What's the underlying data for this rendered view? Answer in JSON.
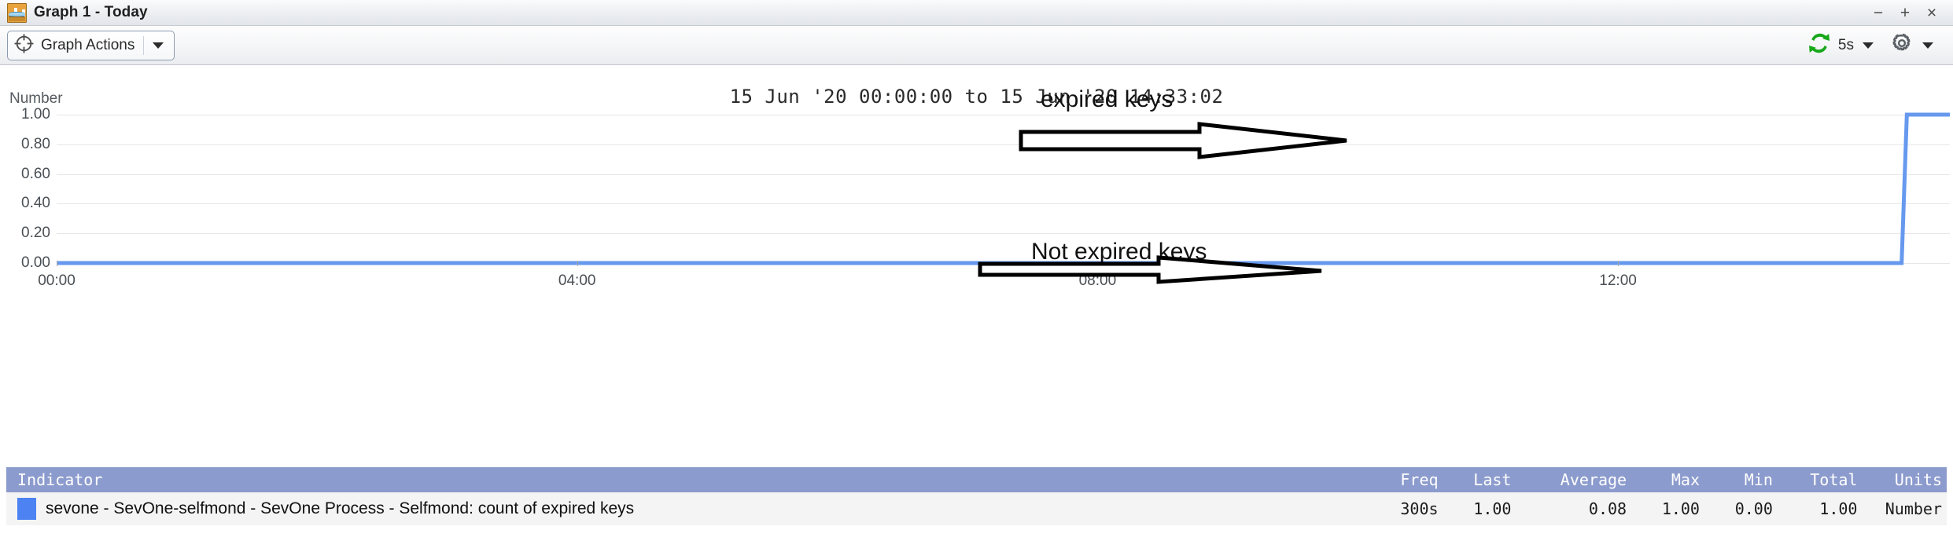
{
  "window": {
    "title": "Graph 1 - Today",
    "app_icon": "graph-chart-icon",
    "controls": {
      "minimize": "−",
      "maximize": "+",
      "close": "×"
    }
  },
  "toolbar": {
    "graph_actions_label": "Graph Actions",
    "graph_actions_icon": "crosshair-target-icon",
    "refresh_icon": "refresh-cycle-icon",
    "refresh_interval": "5s",
    "settings_icon": "gear-icon",
    "accent_green": "#17a81a"
  },
  "chart_data": {
    "type": "line",
    "title": "15 Jun '20 00:00:00 to 15 Jun '20 14:33:02",
    "xlabel": "",
    "ylabel": "Number",
    "ylim": [
      0,
      1
    ],
    "yticks": [
      "1.00",
      "0.80",
      "0.60",
      "0.40",
      "0.20",
      "0.00"
    ],
    "ytick_values": [
      1.0,
      0.8,
      0.6,
      0.4,
      0.2,
      0.0
    ],
    "xticks": [
      "00:00",
      "04:00",
      "08:00",
      "12:00"
    ],
    "xtick_hours": [
      0,
      4,
      8,
      12
    ],
    "xlim_hours": [
      0,
      14.5506
    ],
    "grid": true,
    "legend_position": "bottom-table",
    "series": [
      {
        "name": "sevone - SevOne-selfmond - SevOne Process - Selfmond: count of expired keys",
        "color": "#6699ee",
        "x_hours": [
          0,
          14.18,
          14.22,
          14.5506
        ],
        "values": [
          0,
          0,
          1,
          1
        ]
      }
    ],
    "annotations": [
      {
        "text": "expired keys",
        "arrow": "block-arrow-right",
        "points_to": "spike-top"
      },
      {
        "text": "Not expired keys",
        "arrow": "block-arrow-right",
        "points_to": "baseline"
      }
    ]
  },
  "legend": {
    "columns": [
      "Indicator",
      "Freq",
      "Last",
      "Average",
      "Max",
      "Min",
      "Total",
      "Units"
    ],
    "header_bg": "#8c9bcd",
    "rows": [
      {
        "swatch_color": "#4d82f3",
        "indicator": "sevone - SevOne-selfmond - SevOne Process - Selfmond: count of expired keys",
        "freq": "300s",
        "last": "1.00",
        "average": "0.08",
        "max": "1.00",
        "min": "0.00",
        "total": "1.00",
        "units": "Number"
      }
    ]
  }
}
